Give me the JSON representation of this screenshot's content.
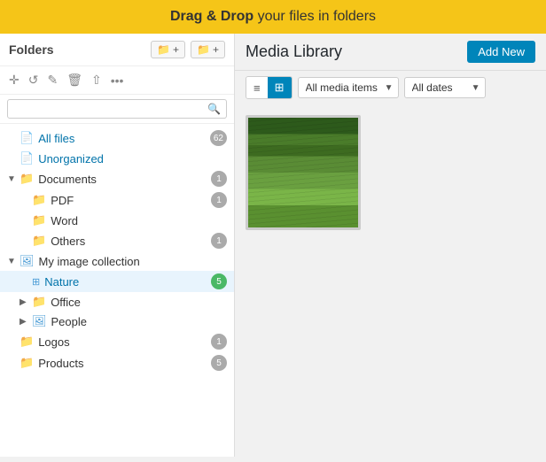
{
  "banner": {
    "text_bold": "Drag & Drop",
    "text_rest": " your files in folders"
  },
  "sidebar": {
    "title": "Folders",
    "btn_add_folder": "+",
    "btn_upload": "+",
    "toolbar": {
      "move_icon": "⊕",
      "refresh_icon": "↺",
      "edit_icon": "✎",
      "delete_icon": "🗑",
      "upload_icon": "↑",
      "more_icon": "…"
    },
    "search_placeholder": "",
    "tree": [
      {
        "id": "all-files",
        "label": "All files",
        "indent": 0,
        "icon": "📄",
        "icon_type": "file",
        "badge": "62",
        "chevron": ""
      },
      {
        "id": "unorganized",
        "label": "Unorganized",
        "indent": 0,
        "icon": "📄",
        "icon_type": "file",
        "badge": "",
        "chevron": ""
      },
      {
        "id": "documents",
        "label": "Documents",
        "indent": 0,
        "icon": "📁",
        "icon_type": "folder",
        "badge": "1",
        "chevron": "▼"
      },
      {
        "id": "pdf",
        "label": "PDF",
        "indent": 1,
        "icon": "📁",
        "icon_type": "folder",
        "badge": "1",
        "chevron": ""
      },
      {
        "id": "word",
        "label": "Word",
        "indent": 1,
        "icon": "📁",
        "icon_type": "folder",
        "badge": "",
        "chevron": ""
      },
      {
        "id": "others",
        "label": "Others",
        "indent": 1,
        "icon": "📁",
        "icon_type": "folder",
        "badge": "1",
        "chevron": ""
      },
      {
        "id": "my-image-collection",
        "label": "My image collection",
        "indent": 0,
        "icon": "🖼",
        "icon_type": "image-folder",
        "badge": "",
        "chevron": "▼"
      },
      {
        "id": "nature",
        "label": "Nature",
        "indent": 1,
        "icon": "⊞",
        "icon_type": "grid",
        "badge": "5",
        "chevron": ""
      },
      {
        "id": "office",
        "label": "Office",
        "indent": 1,
        "icon": "📁",
        "icon_type": "folder",
        "badge": "",
        "chevron": "▶"
      },
      {
        "id": "people",
        "label": "People",
        "indent": 1,
        "icon": "🖼",
        "icon_type": "image-folder",
        "badge": "",
        "chevron": "▶"
      },
      {
        "id": "logos",
        "label": "Logos",
        "indent": 0,
        "icon": "📁",
        "icon_type": "folder",
        "badge": "1",
        "chevron": ""
      },
      {
        "id": "products",
        "label": "Products",
        "indent": 0,
        "icon": "📁",
        "icon_type": "folder",
        "badge": "5",
        "chevron": ""
      }
    ]
  },
  "content": {
    "title": "Media Library",
    "add_new_label": "Add New",
    "filter_media": "All media items",
    "filter_dates": "All dates",
    "view_list_icon": "≡",
    "view_grid_icon": "⊞",
    "media_items": [
      {
        "id": "grass",
        "alt": "Nature grass field"
      }
    ]
  }
}
